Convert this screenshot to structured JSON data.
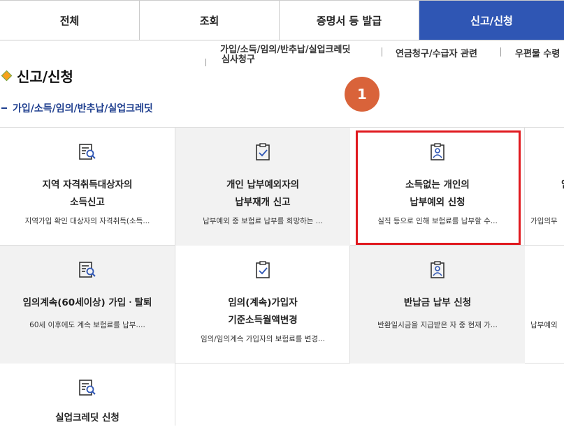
{
  "tabs": [
    {
      "label": "전체"
    },
    {
      "label": "조회"
    },
    {
      "label": "증명서 등 발급"
    },
    {
      "label": "신고/신청"
    }
  ],
  "subnav": {
    "item1_line1": "가입/소득/임의/반추납/실업크레딧",
    "item1_line2": "심사청구",
    "item2": "연금청구/수급자 관련",
    "item3": "우편물 수령"
  },
  "heading": "신고/신청",
  "subheading": "가입/소득/임의/반추납/실업크레딧",
  "step_badge": "1",
  "cards": [
    {
      "title1": "지역 자격취득대상자의",
      "title2": "소득신고",
      "desc": "지역가입 확인 대상자의 자격취득(소득..."
    },
    {
      "title1": "개인 납부예외자의",
      "title2": "납부재개 신고",
      "desc": "납부예외 중 보험료 납부를 희망하는 ..."
    },
    {
      "title1": "소득없는 개인의",
      "title2": "납부예외 신청",
      "desc": "실직 등으로 인해 보험료를 납부할 수..."
    },
    {
      "title1": "임",
      "title2": "",
      "desc": "가입의무"
    },
    {
      "title1": "임의계속(60세이상) 가입ㆍ탈퇴",
      "title2": "",
      "desc": "60세 이후에도 계속 보험료를 납부...."
    },
    {
      "title1": "임의(계속)가입자",
      "title2": "기준소득월액변경",
      "desc": "임의/임의계속 가입자의 보험료를 변경..."
    },
    {
      "title1": "반납금 납부 신청",
      "title2": "",
      "desc": "반환일시금을 지급받은 자 중 현재 가..."
    },
    {
      "title1": "",
      "title2": "",
      "desc": "납부예외"
    },
    {
      "title1": "실업크레딧 신청",
      "title2": "",
      "desc": ""
    }
  ],
  "colors": {
    "active_tab": "#2f56b4",
    "badge": "#d9633a",
    "highlight": "#e0191f",
    "subheading": "#1f3f8f"
  }
}
